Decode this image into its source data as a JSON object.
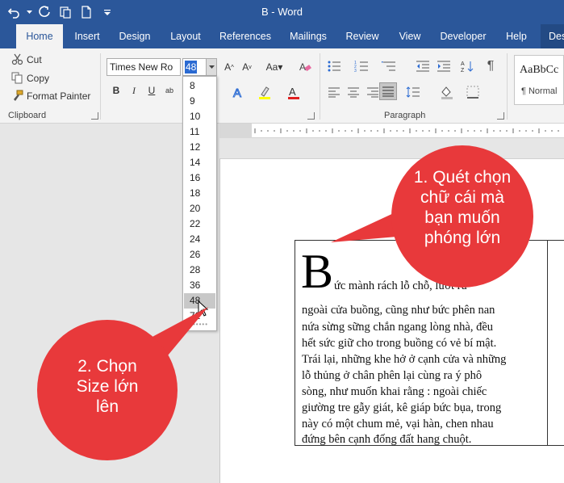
{
  "window": {
    "title": "B  -  Word"
  },
  "tabs": [
    {
      "label": "Home",
      "active": true
    },
    {
      "label": "Insert"
    },
    {
      "label": "Design"
    },
    {
      "label": "Layout"
    },
    {
      "label": "References"
    },
    {
      "label": "Mailings"
    },
    {
      "label": "Review"
    },
    {
      "label": "View"
    },
    {
      "label": "Developer"
    },
    {
      "label": "Help"
    },
    {
      "label": "Des"
    }
  ],
  "clipboard": {
    "cut": "Cut",
    "copy": "Copy",
    "format_painter": "Format Painter",
    "group_label": "Clipboard"
  },
  "font": {
    "name": "Times New Ro",
    "size": "48"
  },
  "paragraph": {
    "group_label": "Paragraph"
  },
  "styles": {
    "preview": "AaBbCc",
    "normal": "¶ Normal"
  },
  "font_size_options": [
    "8",
    "9",
    "10",
    "11",
    "12",
    "14",
    "16",
    "18",
    "20",
    "22",
    "24",
    "26",
    "28",
    "36",
    "48",
    "72"
  ],
  "font_size_highlighted": "48",
  "document": {
    "dropcap": "B",
    "lines": [
      "ức mành rách lỗ chỗ, lướt rủ",
      "ngoài cửa buồng, cũng như bức phên nan",
      "nứa sừng sững chắn ngang lòng nhà, đều",
      "hết sức giữ cho trong buồng có vẻ bí mật.",
      "Trái lại, những khe hở ở cạnh cửa và những",
      "lỗ thủng ở chân phên lại cùng ra ý phô",
      "sòng, như muốn khai rằng : ngoài chiếc",
      "giường tre gẫy giát, kê giáp bức bụa, trong",
      "này có một chum mẻ, vại hàn, chen nhau",
      "đứng bên cạnh đống đất hang chuột."
    ]
  },
  "callouts": {
    "one": [
      "1. Quét chọn",
      "chữ cái mà",
      "bạn muốn",
      "phóng lớn"
    ],
    "two": [
      "2. Chọn",
      "Size lớn",
      "lên"
    ],
    "color": "#e8393b"
  },
  "colors": {
    "title_bar": "#2b579a",
    "ribbon": "#f3f3f3",
    "accent": "#2a6ad2"
  }
}
